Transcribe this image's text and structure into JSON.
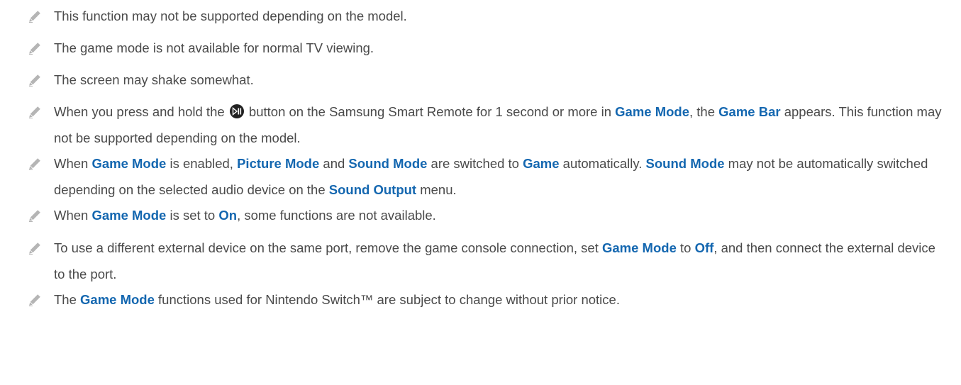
{
  "notes": [
    {
      "segments": [
        {
          "text": "This function may not be supported depending on the model."
        }
      ]
    },
    {
      "segments": [
        {
          "text": "The game mode is not available for normal TV viewing."
        }
      ]
    },
    {
      "segments": [
        {
          "text": "The screen may shake somewhat."
        }
      ]
    },
    {
      "segments": [
        {
          "text": "When you press and hold the "
        },
        {
          "icon": "play-pause-button-icon"
        },
        {
          "text": " button on the Samsung Smart Remote for 1 second or more in "
        },
        {
          "text": "Game Mode",
          "term": true
        },
        {
          "text": ", the "
        },
        {
          "text": "Game Bar",
          "term": true
        },
        {
          "text": " appears. This function may not be supported depending on the model."
        }
      ]
    },
    {
      "segments": [
        {
          "text": "When "
        },
        {
          "text": "Game Mode",
          "term": true
        },
        {
          "text": " is enabled, "
        },
        {
          "text": "Picture Mode",
          "term": true
        },
        {
          "text": " and "
        },
        {
          "text": "Sound Mode",
          "term": true
        },
        {
          "text": " are switched to "
        },
        {
          "text": "Game",
          "term": true
        },
        {
          "text": " automatically. "
        },
        {
          "text": "Sound Mode",
          "term": true
        },
        {
          "text": " may not be automatically switched depending on the selected audio device on the "
        },
        {
          "text": "Sound Output",
          "term": true
        },
        {
          "text": " menu."
        }
      ]
    },
    {
      "segments": [
        {
          "text": "When "
        },
        {
          "text": "Game Mode",
          "term": true
        },
        {
          "text": " is set to "
        },
        {
          "text": "On",
          "term": true
        },
        {
          "text": ", some functions are not available."
        }
      ]
    },
    {
      "segments": [
        {
          "text": "To use a different external device on the same port, remove the game console connection, set "
        },
        {
          "text": "Game Mode",
          "term": true
        },
        {
          "text": " to "
        },
        {
          "text": "Off",
          "term": true
        },
        {
          "text": ", and then connect the external device to the port."
        }
      ]
    },
    {
      "segments": [
        {
          "text": "The "
        },
        {
          "text": "Game Mode",
          "term": true
        },
        {
          "text": " functions used for Nintendo Switch™ are subject to change without prior notice."
        }
      ]
    }
  ],
  "icons": {
    "note": "pencil-icon",
    "remote_button": "play-pause-button-icon"
  },
  "colors": {
    "text": "#4a4a4a",
    "term": "#1467b0",
    "icon": "#b5b5b5"
  }
}
